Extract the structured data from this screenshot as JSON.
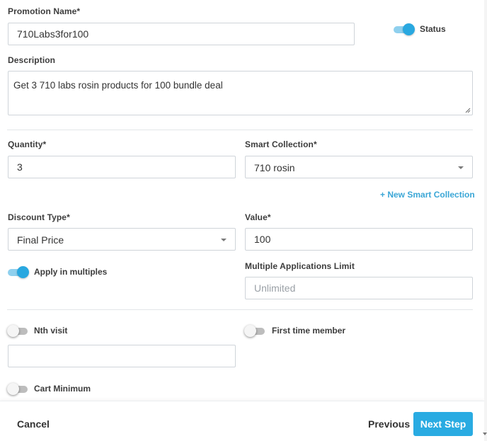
{
  "promotion_name": {
    "label": "Promotion Name*",
    "value": "710Labs3for100"
  },
  "status": {
    "label": "Status",
    "on": true
  },
  "description": {
    "label": "Description",
    "value": "Get 3 710 labs rosin products for 100 bundle deal"
  },
  "quantity": {
    "label": "Quantity*",
    "value": "3"
  },
  "smart_collection": {
    "label": "Smart Collection*",
    "value": "710 rosin",
    "new_link": "+ New Smart Collection"
  },
  "discount_type": {
    "label": "Discount Type*",
    "value": "Final Price"
  },
  "value_field": {
    "label": "Value*",
    "value": "100"
  },
  "apply_multiples": {
    "label": "Apply in multiples",
    "on": true
  },
  "multiple_limit": {
    "label": "Multiple Applications Limit",
    "placeholder": "Unlimited"
  },
  "nth_visit": {
    "label": "Nth visit",
    "on": false,
    "value": ""
  },
  "first_time_member": {
    "label": "First time member",
    "on": false
  },
  "cart_minimum": {
    "label": "Cart Minimum",
    "on": false
  },
  "footer": {
    "cancel": "Cancel",
    "previous": "Previous",
    "next": "Next Step"
  },
  "colors": {
    "accent": "#29abe2",
    "link": "#3aa6d6",
    "toggle_on": "#29a8e0"
  }
}
